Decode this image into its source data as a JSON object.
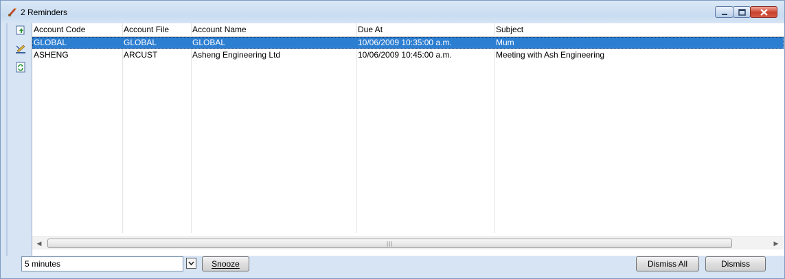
{
  "window": {
    "title": "2 Reminders"
  },
  "columns": [
    "Account Code",
    "Account File",
    "Account Name",
    "Due At",
    "Subject"
  ],
  "rows": [
    {
      "code": "GLOBAL",
      "file": "GLOBAL",
      "name": "GLOBAL",
      "due": "10/06/2009 10:35:00 a.m.",
      "subject": "Mum",
      "selected": true
    },
    {
      "code": "ASHENG",
      "file": "ARCUST",
      "name": "Asheng Engineering Ltd",
      "due": "10/06/2009 10:45:00 a.m.",
      "subject": "Meeting with Ash Engineering",
      "selected": false
    }
  ],
  "snooze": {
    "selected_value": "5 minutes",
    "button_label": "Snooze"
  },
  "dismiss_all_label": "Dismiss All",
  "dismiss_label": "Dismiss",
  "colors": {
    "selection": "#2c7ed1",
    "close_button": "#c8412b"
  },
  "icons": {
    "title": "reminder-bell-icon",
    "toolbar": [
      "open-item-icon",
      "edit-item-icon",
      "refresh-icon"
    ]
  }
}
